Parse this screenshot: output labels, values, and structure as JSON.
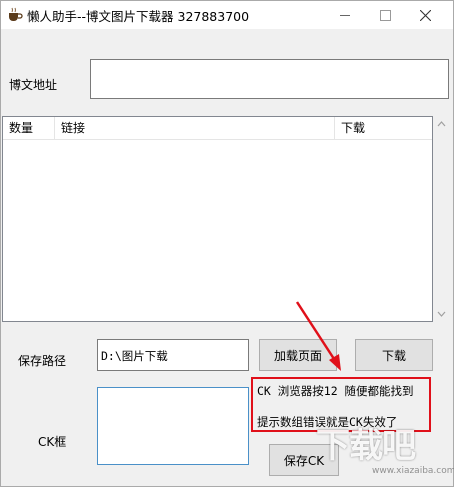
{
  "window": {
    "title": "懒人助手--博文图片下载器  327883700",
    "controls": {
      "minimize": "—",
      "maximize": "□",
      "close": "✕"
    }
  },
  "url_section": {
    "label": "博文地址",
    "value": ""
  },
  "list": {
    "columns": [
      "数量",
      "链接",
      "下载"
    ],
    "rows": []
  },
  "save_path": {
    "label": "保存路径",
    "value": "D:\\图片下载"
  },
  "buttons": {
    "load_page": "加载页面",
    "download": "下载",
    "save_ck": "保存CK"
  },
  "ck": {
    "label": "CK框",
    "value": ""
  },
  "annotation": {
    "line1": "CK 浏览器按12 随便都能找到",
    "line2": "提示数组错误就是CK失效了",
    "color": "#e0101a"
  },
  "watermark": {
    "text": "下载吧",
    "url": "www.xiazaiba.com"
  },
  "icons": {
    "app": "coffee-cup-icon"
  }
}
